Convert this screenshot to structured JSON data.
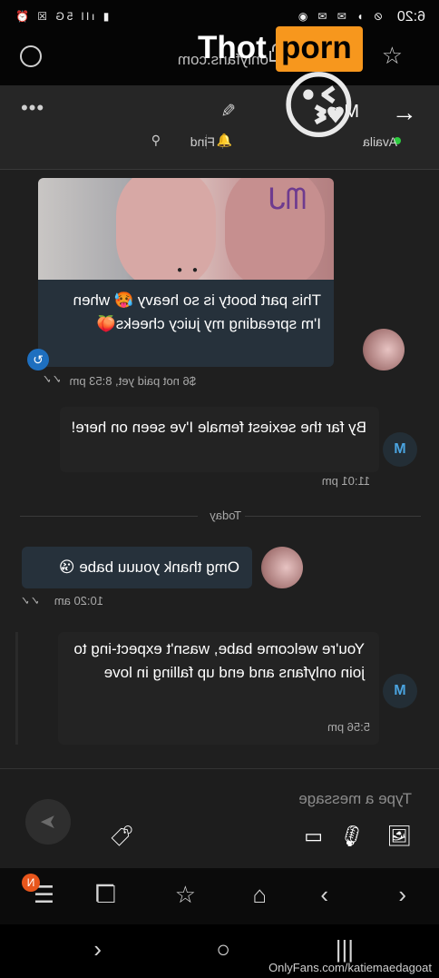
{
  "status_bar": {
    "time": "6:20",
    "right_icons": "▮ ıll 5G ☒ ⏰",
    "left_icons": "⊘ ◗ ✉ ✉ ◉"
  },
  "browser": {
    "url": "onlyfans.com"
  },
  "sticker": {
    "logo_white": "Thot",
    "logo_orange": "porn",
    "emoji": "😘"
  },
  "chat_header": {
    "name_visible": "M       n",
    "status": "Availa",
    "find_label": "Find"
  },
  "messages": [
    {
      "type": "incoming",
      "text": "This part booty is so heavy 🥵 when I'm spreading my juicy cheeks🍑",
      "meta": "$6 not paid yet, 8:53 pm"
    },
    {
      "type": "outgoing",
      "avatar_letter": "M",
      "text": "By far the sexiest female I've seen on here!",
      "meta": "11:01 pm"
    },
    {
      "type": "incoming",
      "text": "Omg thank youuu babe 😘",
      "meta": "10:20 am"
    },
    {
      "type": "outgoing",
      "avatar_letter": "M",
      "text": "You're welcome babe, wasn't expect-ing to join onlyfans and end up falling in love",
      "meta": "5:56 pm"
    }
  ],
  "date_divider": "Today",
  "media_watermark": "OnlyFans.com/katiemaedagoat",
  "input": {
    "placeholder": "Type a message"
  },
  "nav": {
    "tabs_badge": "N"
  },
  "footer": "OnlyFans.com/katiemaedagoat"
}
